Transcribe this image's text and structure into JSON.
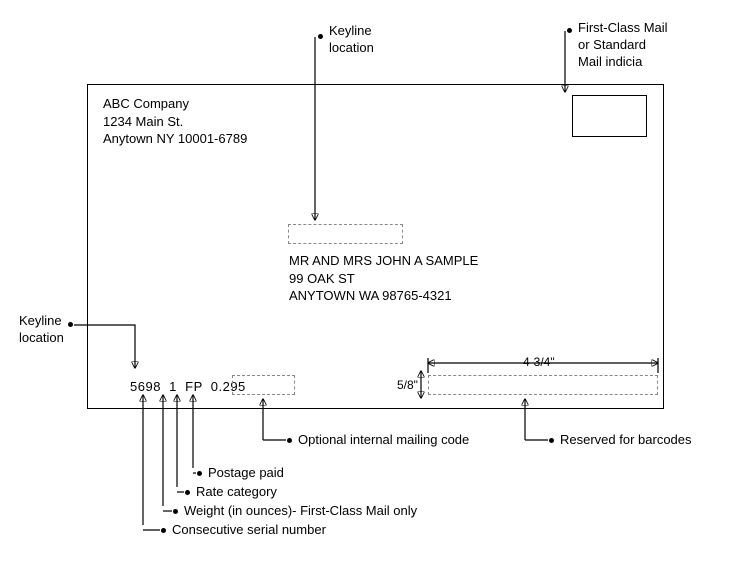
{
  "callouts": {
    "keyline_top": "Keyline\nlocation",
    "indicia": "First-Class Mail\nor Standard\nMail indicia",
    "keyline_left": "Keyline\nlocation",
    "optional_code": "Optional internal mailing code",
    "reserved_barcode": "Reserved for barcodes",
    "postage_paid": "Postage paid",
    "rate_category": "Rate category",
    "weight": "Weight (in ounces)- First-Class Mail only",
    "serial": "Consecutive serial number"
  },
  "return_address": {
    "line1": "ABC Company",
    "line2": "1234 Main St.",
    "line3": "Anytown  NY 10001-6789"
  },
  "recipient_address": {
    "line1": "MR AND MRS JOHN A SAMPLE",
    "line2": "99 OAK ST",
    "line3": "ANYTOWN WA 98765-4321"
  },
  "keyline": {
    "serial": "5698",
    "weight": "1",
    "rate": "FP",
    "postage": "0.295"
  },
  "dimensions": {
    "height": "5/8\"",
    "width": "4-3/4\""
  }
}
